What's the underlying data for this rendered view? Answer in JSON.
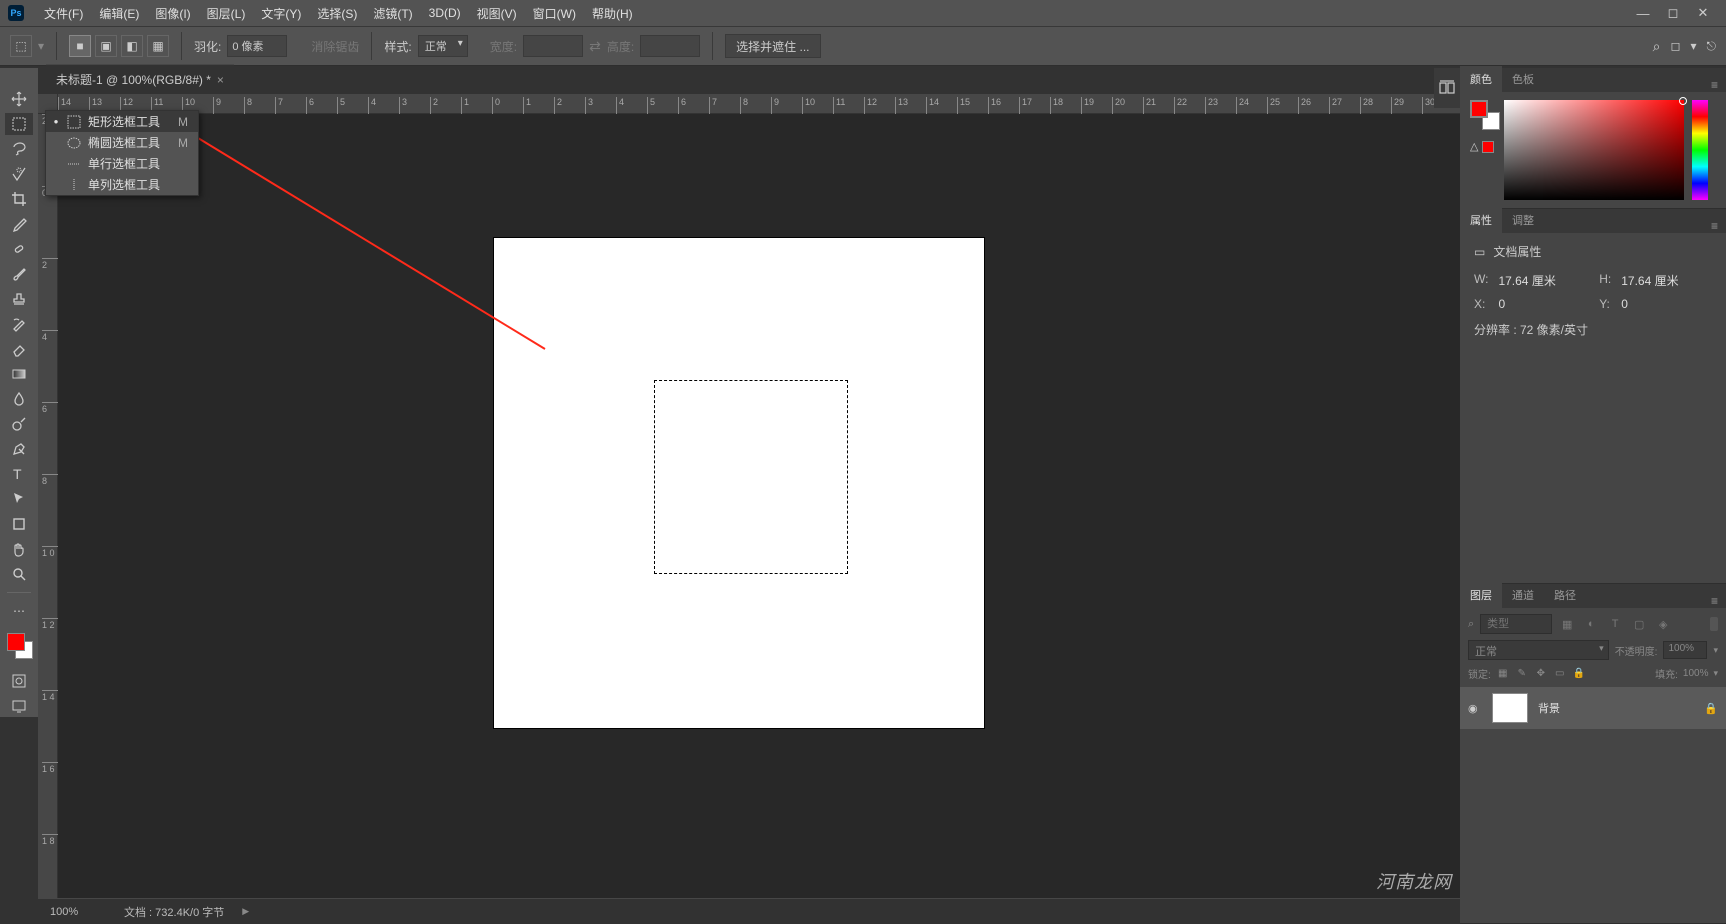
{
  "app": {
    "logo": "Ps"
  },
  "menu": {
    "items": [
      "文件(F)",
      "编辑(E)",
      "图像(I)",
      "图层(L)",
      "文字(Y)",
      "选择(S)",
      "滤镜(T)",
      "3D(D)",
      "视图(V)",
      "窗口(W)",
      "帮助(H)"
    ]
  },
  "options": {
    "feather_label": "羽化:",
    "feather_value": "0 像素",
    "anti_alias": "消除锯齿",
    "style_label": "样式:",
    "style_value": "正常",
    "width_label": "宽度:",
    "height_label": "高度:",
    "select_mask": "选择并遮住 ..."
  },
  "tab": {
    "title": "未标题-1 @ 100%(RGB/8#) *"
  },
  "flyout": {
    "items": [
      {
        "label": "矩形选框工具",
        "shortcut": "M",
        "active": true
      },
      {
        "label": "椭圆选框工具",
        "shortcut": "M",
        "active": false
      },
      {
        "label": "单行选框工具",
        "shortcut": "",
        "active": false
      },
      {
        "label": "单列选框工具",
        "shortcut": "",
        "active": false
      }
    ]
  },
  "ruler_h": [
    "14",
    "13",
    "12",
    "11",
    "10",
    "9",
    "8",
    "7",
    "6",
    "5",
    "4",
    "3",
    "2",
    "1",
    "0",
    "1",
    "2",
    "3",
    "4",
    "5",
    "6",
    "7",
    "8",
    "9",
    "10",
    "11",
    "12",
    "13",
    "14",
    "15",
    "16",
    "17",
    "18",
    "19",
    "20",
    "21",
    "22",
    "23",
    "24",
    "25",
    "26",
    "27",
    "28",
    "29",
    "30"
  ],
  "ruler_v": [
    "2",
    "0",
    "2",
    "4",
    "6",
    "8",
    "1 0",
    "1 2",
    "1 4",
    "1 6",
    "1 8"
  ],
  "color_panel": {
    "tab1": "颜色",
    "tab2": "色板"
  },
  "props_panel": {
    "tab1": "属性",
    "tab2": "调整",
    "title": "文档属性",
    "w_label": "W:",
    "w_value": "17.64 厘米",
    "h_label": "H:",
    "h_value": "17.64 厘米",
    "x_label": "X:",
    "x_value": "0",
    "y_label": "Y:",
    "y_value": "0",
    "res": "分辨率 : 72 像素/英寸"
  },
  "layers_panel": {
    "tab1": "图层",
    "tab2": "通道",
    "tab3": "路径",
    "search_placeholder": "类型",
    "blend_mode": "正常",
    "opacity_label": "不透明度:",
    "opacity_value": "100%",
    "lock_label": "锁定:",
    "fill_label": "填充:",
    "fill_value": "100%",
    "layer_name": "背景"
  },
  "status": {
    "zoom": "100%",
    "doc_info": "文档 : 732.4K/0 字节"
  },
  "watermark": "河南龙网"
}
